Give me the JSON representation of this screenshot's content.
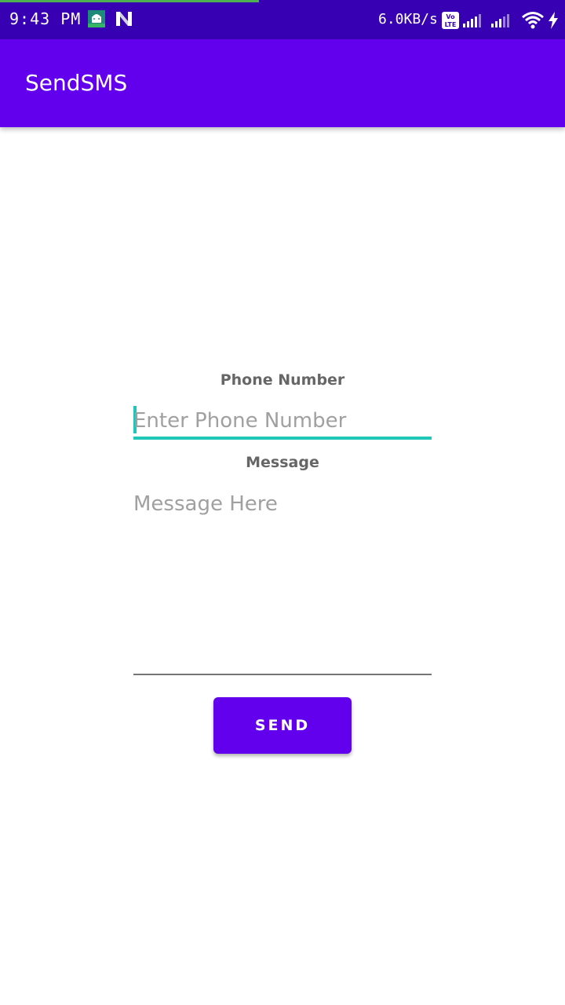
{
  "status_bar": {
    "time": "9:43 PM",
    "notification_icons": [
      "android-debug-icon",
      "n-app-icon"
    ],
    "net_speed": "6.0KB/s",
    "volte_label": "Vo LTE",
    "icons": [
      "volte-icon",
      "signal-icon",
      "signal-icon",
      "wifi-icon",
      "charging-icon"
    ],
    "colors": {
      "background": "#3700b3",
      "progress": "#4caf50"
    }
  },
  "app_bar": {
    "title": "SendSMS",
    "color": "#6200ee"
  },
  "form": {
    "phone_label": "Phone Number",
    "phone_placeholder": "Enter Phone Number",
    "phone_value": "",
    "message_label": "Message",
    "message_placeholder": "Message Here",
    "message_value": "",
    "send_label": "SEND",
    "accent_color": "#1fc7b8",
    "button_color": "#6200ee"
  }
}
